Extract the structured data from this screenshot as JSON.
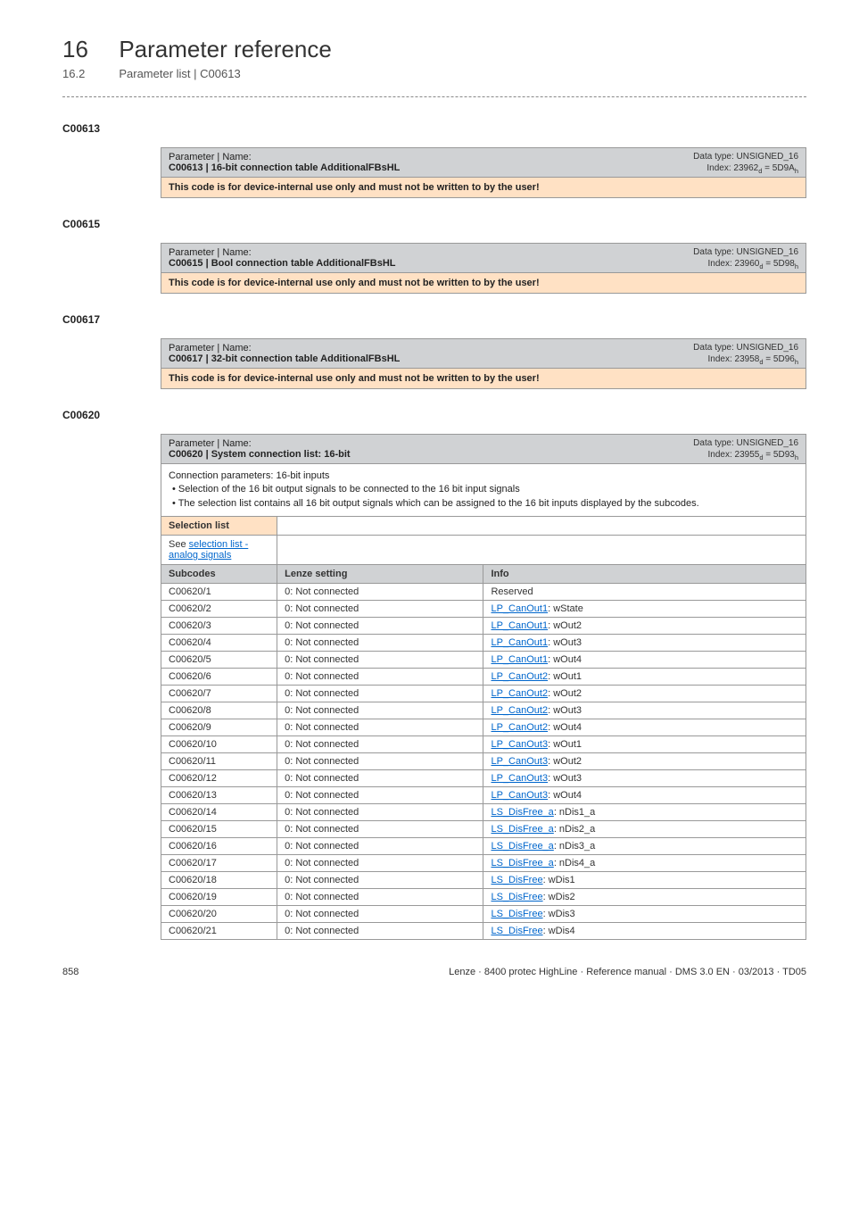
{
  "header": {
    "chapter_num": "16",
    "chapter_title": "Parameter reference",
    "sub_num": "16.2",
    "sub_title": "Parameter list | C00613"
  },
  "sections": [
    {
      "code": "C00613",
      "param_label": "Parameter | Name:",
      "param_name": "C00613 | 16-bit connection table AdditionalFBsHL",
      "meta_type": "Data type: UNSIGNED_16",
      "meta_index": "Index: 23962",
      "meta_index_sub": "d",
      "meta_index_eq": " = 5D9A",
      "meta_index_sub2": "h",
      "warn": "This code is for device-internal use only and must not be written to by the user!"
    },
    {
      "code": "C00615",
      "param_label": "Parameter | Name:",
      "param_name": "C00615 | Bool connection table AdditionalFBsHL",
      "meta_type": "Data type: UNSIGNED_16",
      "meta_index": "Index: 23960",
      "meta_index_sub": "d",
      "meta_index_eq": " = 5D98",
      "meta_index_sub2": "h",
      "warn": "This code is for device-internal use only and must not be written to by the user!"
    },
    {
      "code": "C00617",
      "param_label": "Parameter | Name:",
      "param_name": "C00617 | 32-bit connection table AdditionalFBsHL",
      "meta_type": "Data type: UNSIGNED_16",
      "meta_index": "Index: 23958",
      "meta_index_sub": "d",
      "meta_index_eq": " = 5D96",
      "meta_index_sub2": "h",
      "warn": "This code is for device-internal use only and must not be written to by the user!"
    }
  ],
  "detail": {
    "code": "C00620",
    "param_label": "Parameter | Name:",
    "param_name": "C00620 | System connection list: 16-bit",
    "meta_type": "Data type: UNSIGNED_16",
    "meta_index": "Index: 23955",
    "meta_index_sub": "d",
    "meta_index_eq": " = 5D93",
    "meta_index_sub2": "h",
    "desc_line1": "Connection parameters: 16-bit inputs",
    "desc_bullet1": "• Selection of the 16 bit output signals to be connected to the 16 bit input signals",
    "desc_bullet2": "• The selection list contains all 16 bit output signals which can be assigned to the 16 bit inputs displayed by the subcodes.",
    "selection_label": "Selection list",
    "selection_link_prefix": "See ",
    "selection_link": "selection list - analog signals",
    "col_subcodes": "Subcodes",
    "col_setting": "Lenze setting",
    "col_info": "Info",
    "rows": [
      {
        "sub": "C00620/1",
        "set": "0: Not connected",
        "info_link": "",
        "info_plain": "Reserved"
      },
      {
        "sub": "C00620/2",
        "set": "0: Not connected",
        "info_link": "LP_CanOut1",
        "info_rest": ": wState"
      },
      {
        "sub": "C00620/3",
        "set": "0: Not connected",
        "info_link": "LP_CanOut1",
        "info_rest": ": wOut2"
      },
      {
        "sub": "C00620/4",
        "set": "0: Not connected",
        "info_link": "LP_CanOut1",
        "info_rest": ": wOut3"
      },
      {
        "sub": "C00620/5",
        "set": "0: Not connected",
        "info_link": "LP_CanOut1",
        "info_rest": ": wOut4"
      },
      {
        "sub": "C00620/6",
        "set": "0: Not connected",
        "info_link": "LP_CanOut2",
        "info_rest": ": wOut1"
      },
      {
        "sub": "C00620/7",
        "set": "0: Not connected",
        "info_link": "LP_CanOut2",
        "info_rest": ": wOut2"
      },
      {
        "sub": "C00620/8",
        "set": "0: Not connected",
        "info_link": "LP_CanOut2",
        "info_rest": ": wOut3"
      },
      {
        "sub": "C00620/9",
        "set": "0: Not connected",
        "info_link": "LP_CanOut2",
        "info_rest": ": wOut4"
      },
      {
        "sub": "C00620/10",
        "set": "0: Not connected",
        "info_link": "LP_CanOut3",
        "info_rest": ": wOut1"
      },
      {
        "sub": "C00620/11",
        "set": "0: Not connected",
        "info_link": "LP_CanOut3",
        "info_rest": ": wOut2"
      },
      {
        "sub": "C00620/12",
        "set": "0: Not connected",
        "info_link": "LP_CanOut3",
        "info_rest": ": wOut3"
      },
      {
        "sub": "C00620/13",
        "set": "0: Not connected",
        "info_link": "LP_CanOut3",
        "info_rest": ": wOut4"
      },
      {
        "sub": "C00620/14",
        "set": "0: Not connected",
        "info_link": "LS_DisFree_a",
        "info_rest": ": nDis1_a"
      },
      {
        "sub": "C00620/15",
        "set": "0: Not connected",
        "info_link": "LS_DisFree_a",
        "info_rest": ": nDis2_a"
      },
      {
        "sub": "C00620/16",
        "set": "0: Not connected",
        "info_link": "LS_DisFree_a",
        "info_rest": ": nDis3_a"
      },
      {
        "sub": "C00620/17",
        "set": "0: Not connected",
        "info_link": "LS_DisFree_a",
        "info_rest": ": nDis4_a"
      },
      {
        "sub": "C00620/18",
        "set": "0: Not connected",
        "info_link": "LS_DisFree",
        "info_rest": ": wDis1"
      },
      {
        "sub": "C00620/19",
        "set": "0: Not connected",
        "info_link": "LS_DisFree",
        "info_rest": ": wDis2"
      },
      {
        "sub": "C00620/20",
        "set": "0: Not connected",
        "info_link": "LS_DisFree",
        "info_rest": ": wDis3"
      },
      {
        "sub": "C00620/21",
        "set": "0: Not connected",
        "info_link": "LS_DisFree",
        "info_rest": ": wDis4"
      }
    ]
  },
  "footer": {
    "page": "858",
    "right": "Lenze · 8400 protec HighLine · Reference manual · DMS 3.0 EN · 03/2013 · TD05"
  }
}
